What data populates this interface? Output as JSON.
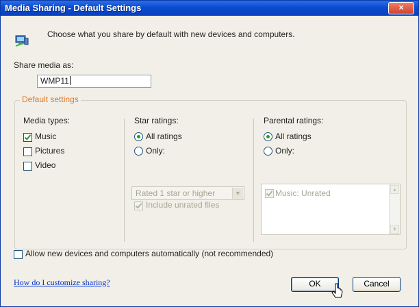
{
  "window": {
    "title": "Media Sharing - Default Settings",
    "close_glyph": "×"
  },
  "intro": {
    "text": "Choose what you share by default with new devices and computers.",
    "icon": "network-computer-icon"
  },
  "share_as": {
    "label": "Share media as:",
    "value": "WMP11"
  },
  "default_settings": {
    "legend": "Default settings",
    "media_types": {
      "label": "Media types:",
      "items": [
        {
          "label": "Music",
          "checked": true
        },
        {
          "label": "Pictures",
          "checked": false
        },
        {
          "label": "Video",
          "checked": false
        }
      ]
    },
    "star_ratings": {
      "label": "Star ratings:",
      "all_label": "All ratings",
      "only_label": "Only:",
      "selected": "all",
      "combo_value": "Rated 1 star or higher",
      "include_unrated_label": "Include unrated files",
      "include_unrated_checked": true
    },
    "parental_ratings": {
      "label": "Parental ratings:",
      "all_label": "All ratings",
      "only_label": "Only:",
      "selected": "all",
      "list_items": [
        {
          "label": "Music: Unrated",
          "checked": true
        }
      ]
    }
  },
  "allow_auto": {
    "label": "Allow new devices and computers automatically (not recommended)",
    "checked": false
  },
  "footer": {
    "help_link": "How do I customize sharing?",
    "ok_label": "OK",
    "cancel_label": "Cancel"
  },
  "colors": {
    "titlebar": "#0a4ccf",
    "legend": "#e0782a",
    "link": "#0033cc",
    "check_mark": "#21a121"
  }
}
